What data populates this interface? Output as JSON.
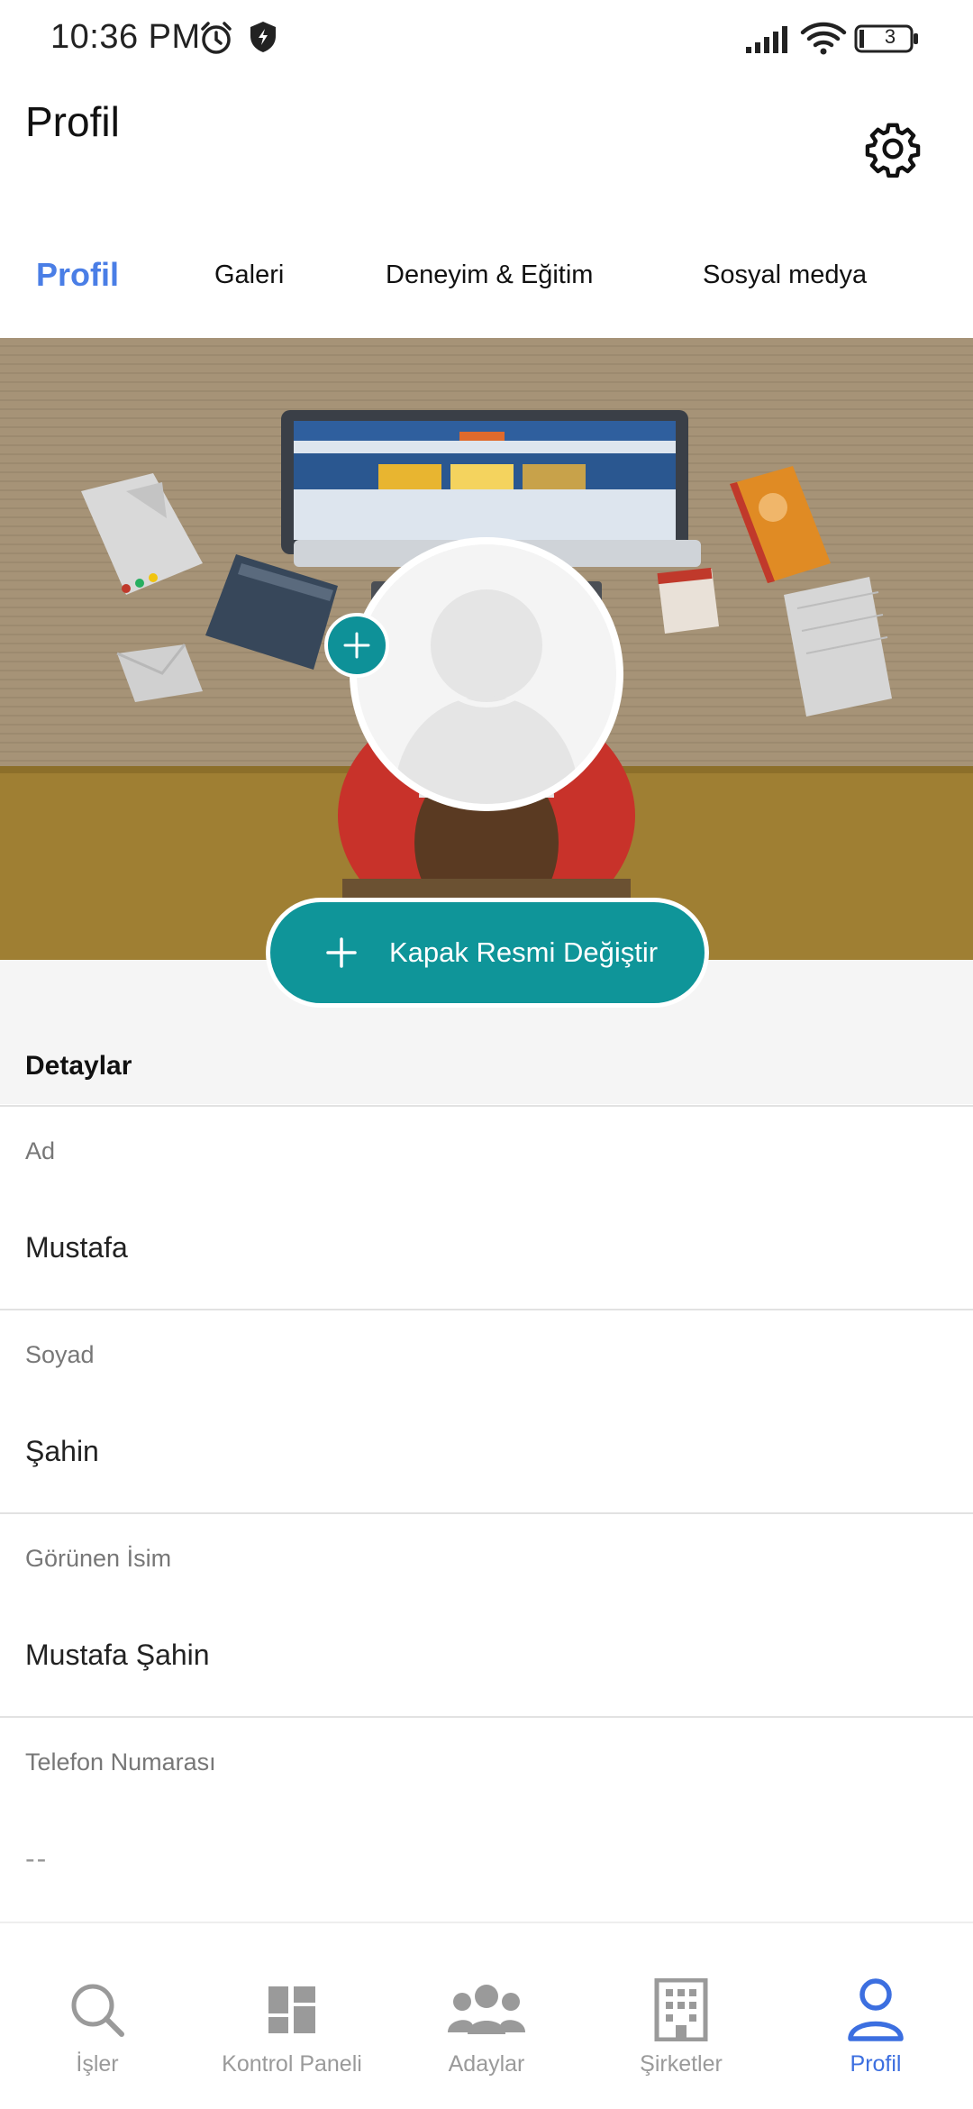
{
  "status_bar": {
    "time": "10:36 PM",
    "battery_level": "3",
    "icons": [
      "alarm-icon",
      "shield-icon",
      "signal-icon",
      "wifi-icon",
      "battery-icon"
    ]
  },
  "header": {
    "title": "Profil",
    "settings_icon": "gear-icon"
  },
  "tabs": [
    {
      "label": "Profil",
      "active": true
    },
    {
      "label": "Galeri",
      "active": false
    },
    {
      "label": "Deneyim & Eğitim",
      "active": false
    },
    {
      "label": "Sosyal medya",
      "active": false
    }
  ],
  "cover": {
    "change_cover_label": "Kapak Resmi Değiştir",
    "accent_color": "#0f9599"
  },
  "details": {
    "title": "Detaylar",
    "fields": [
      {
        "label": "Ad",
        "value": "Mustafa"
      },
      {
        "label": "Soyad",
        "value": "Şahin"
      },
      {
        "label": "Görünen İsim",
        "value": "Mustafa Şahin"
      },
      {
        "label": "Telefon Numarası",
        "value": "--"
      }
    ]
  },
  "bottom_nav": {
    "items": [
      {
        "label": "İşler",
        "icon": "search-icon",
        "active": false
      },
      {
        "label": "Kontrol Paneli",
        "icon": "dashboard-icon",
        "active": false
      },
      {
        "label": "Adaylar",
        "icon": "people-icon",
        "active": false
      },
      {
        "label": "Şirketler",
        "icon": "building-icon",
        "active": false
      },
      {
        "label": "Profil",
        "icon": "person-icon",
        "active": true
      }
    ],
    "active_color": "#3c6fe0",
    "inactive_color": "#9a9a9a"
  }
}
